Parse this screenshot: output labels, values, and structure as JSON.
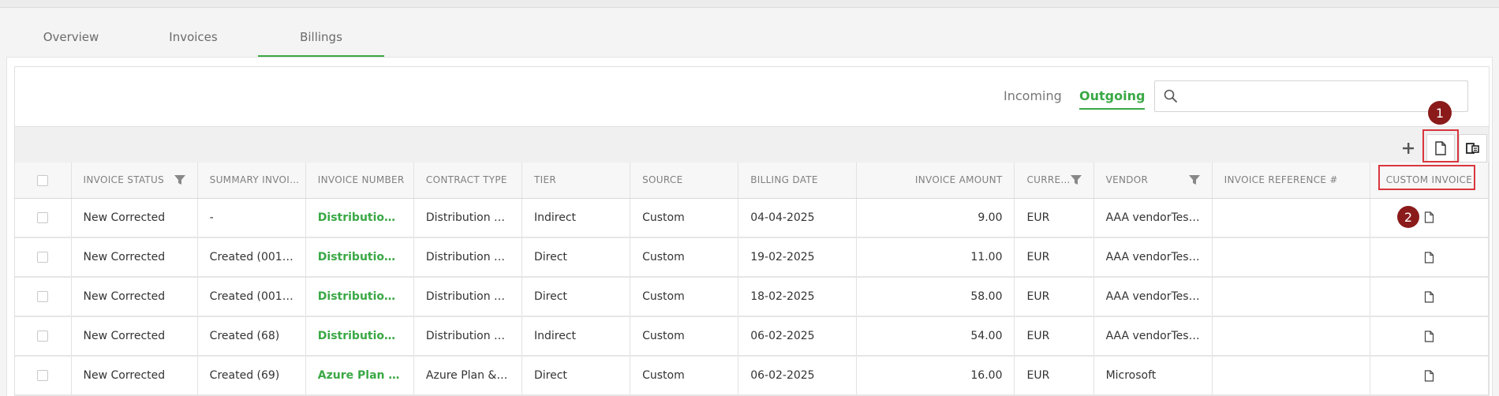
{
  "tabs": [
    {
      "label": "Overview",
      "active": false
    },
    {
      "label": "Invoices",
      "active": false
    },
    {
      "label": "Billings",
      "active": true
    }
  ],
  "toggle": {
    "incoming": "Incoming",
    "outgoing": "Outgoing",
    "selected": "Outgoing"
  },
  "search": {
    "placeholder": "",
    "value": ""
  },
  "toolbar": {
    "icons": [
      "plus-icon",
      "document-icon",
      "export-icon"
    ]
  },
  "annotations": {
    "badge1": "1",
    "badge2": "2",
    "color": "#8b1b1b",
    "highlight_color": "#d9363e"
  },
  "colors": {
    "accent": "#3aa845"
  },
  "table": {
    "columns": [
      {
        "label": "Invoice Status",
        "filter": true
      },
      {
        "label": "Summary Invoi…",
        "filter": false
      },
      {
        "label": "Invoice Number",
        "filter": false
      },
      {
        "label": "Contract Type",
        "filter": false
      },
      {
        "label": "Tier",
        "filter": false
      },
      {
        "label": "Source",
        "filter": false
      },
      {
        "label": "Billing Date",
        "filter": false
      },
      {
        "label": "Invoice Amount",
        "filter": false
      },
      {
        "label": "Curre…",
        "filter": true
      },
      {
        "label": "Vendor",
        "filter": true
      },
      {
        "label": "Invoice Reference #",
        "filter": false
      },
      {
        "label": "Custom Invoice",
        "filter": false
      }
    ],
    "rows": [
      {
        "status": "New Corrected",
        "summary": "-",
        "number": "Distribution S…",
        "contract": "Distribution S…",
        "tier": "Indirect",
        "source": "Custom",
        "date": "04-04-2025",
        "amount": "9.00",
        "currency": "EUR",
        "vendor": "AAA vendorTest…",
        "reference": ""
      },
      {
        "status": "New Corrected",
        "summary": "Created (0010…",
        "number": "Distribution S…",
        "contract": "Distribution S…",
        "tier": "Direct",
        "source": "Custom",
        "date": "19-02-2025",
        "amount": "11.00",
        "currency": "EUR",
        "vendor": "AAA vendorTest…",
        "reference": ""
      },
      {
        "status": "New Corrected",
        "summary": "Created (0010…",
        "number": "Distribution S…",
        "contract": "Distribution S…",
        "tier": "Direct",
        "source": "Custom",
        "date": "18-02-2025",
        "amount": "58.00",
        "currency": "EUR",
        "vendor": "AAA vendorTest…",
        "reference": ""
      },
      {
        "status": "New Corrected",
        "summary": "Created (68)",
        "number": "Distribution S…",
        "contract": "Distribution S…",
        "tier": "Indirect",
        "source": "Custom",
        "date": "06-02-2025",
        "amount": "54.00",
        "currency": "EUR",
        "vendor": "AAA vendorTest…",
        "reference": ""
      },
      {
        "status": "New Corrected",
        "summary": "Created (69)",
        "number": "Azure Plan & …",
        "contract": "Azure Plan & …",
        "tier": "Direct",
        "source": "Custom",
        "date": "06-02-2025",
        "amount": "16.00",
        "currency": "EUR",
        "vendor": "Microsoft",
        "reference": ""
      }
    ]
  }
}
